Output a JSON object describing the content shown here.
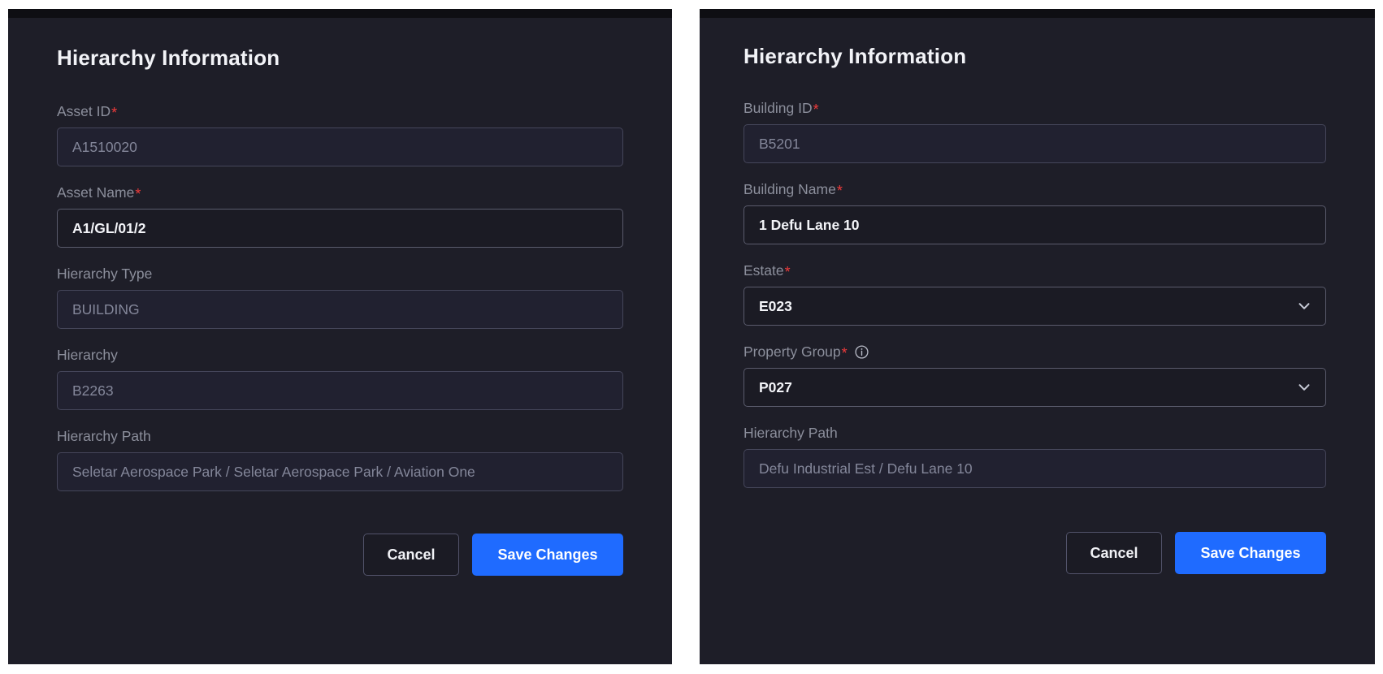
{
  "panels": [
    {
      "title": "Hierarchy Information",
      "fields": [
        {
          "label": "Asset ID",
          "required": true,
          "info": false,
          "type": "readonly",
          "value": "A1510020"
        },
        {
          "label": "Asset Name",
          "required": true,
          "info": false,
          "type": "editable",
          "value": "A1/GL/01/2"
        },
        {
          "label": "Hierarchy Type",
          "required": false,
          "info": false,
          "type": "readonly",
          "value": "BUILDING"
        },
        {
          "label": "Hierarchy",
          "required": false,
          "info": false,
          "type": "readonly",
          "value": "B2263"
        },
        {
          "label": "Hierarchy Path",
          "required": false,
          "info": false,
          "type": "readonly",
          "value": "Seletar Aerospace Park / Seletar Aerospace Park / Aviation One"
        }
      ],
      "cancel_label": "Cancel",
      "save_label": "Save Changes"
    },
    {
      "title": "Hierarchy Information",
      "fields": [
        {
          "label": "Building ID",
          "required": true,
          "info": false,
          "type": "readonly",
          "value": "B5201"
        },
        {
          "label": "Building Name",
          "required": true,
          "info": false,
          "type": "editable",
          "value": "1 Defu Lane 10"
        },
        {
          "label": "Estate",
          "required": true,
          "info": false,
          "type": "select",
          "value": "E023"
        },
        {
          "label": "Property Group",
          "required": true,
          "info": true,
          "type": "select",
          "value": "P027"
        },
        {
          "label": "Hierarchy Path",
          "required": false,
          "info": false,
          "type": "readonly",
          "value": "Defu Industrial Est / Defu Lane 10"
        }
      ],
      "cancel_label": "Cancel",
      "save_label": "Save Changes"
    }
  ],
  "icons": {
    "required_marker": "*",
    "info": "info-icon",
    "chevron": "chevron-down-icon"
  },
  "colors": {
    "panel_background": "#1e1e28",
    "page_background": "#ffffff",
    "label_text": "#8c8f9c",
    "value_text": "#f3f4f8",
    "readonly_text": "#84879a",
    "required_red": "#ef3b3b",
    "primary_blue": "#1f6bff",
    "border": "#4b4c5c"
  }
}
